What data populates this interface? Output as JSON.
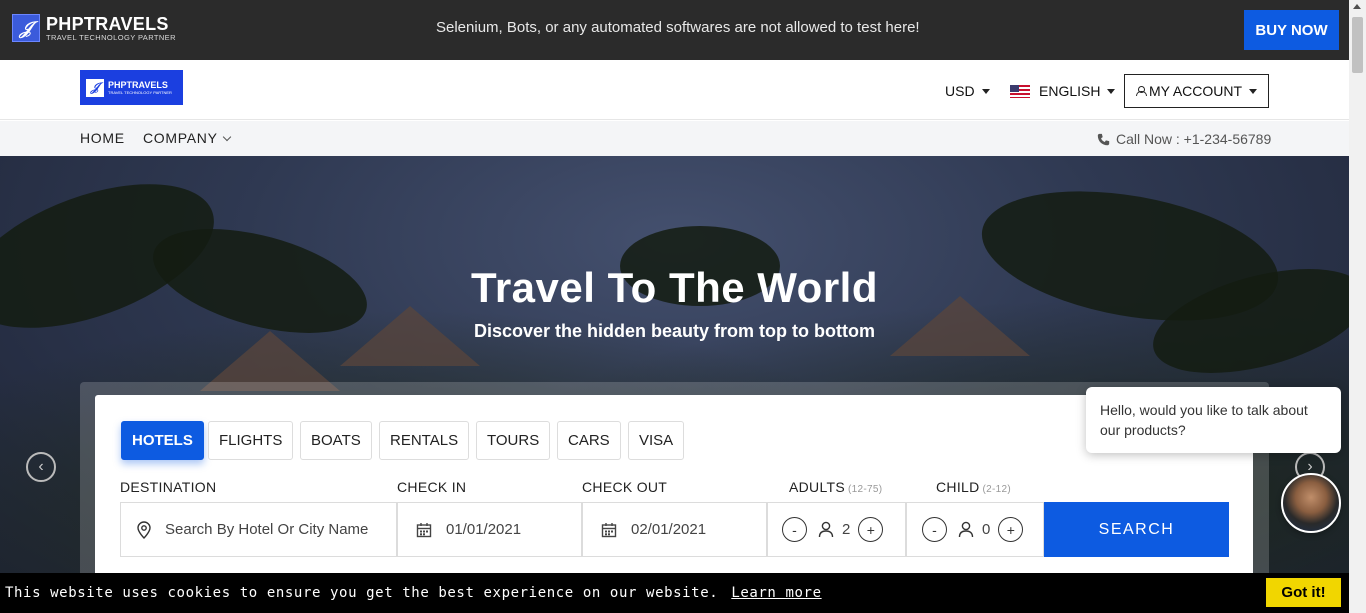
{
  "topbar": {
    "brand": "PHPTRAVELS",
    "brand_sub": "TRAVEL TECHNOLOGY PARTNER",
    "notice": "Selenium, Bots, or any automated softwares are not allowed to test here!",
    "buy_label": "BUY NOW"
  },
  "header": {
    "logo_text": "PHPTRAVELS",
    "logo_sub": "TRAVEL TECHNOLOGY PARTNER",
    "currency": "USD",
    "language": "ENGLISH",
    "account": "MY ACCOUNT"
  },
  "nav": {
    "home": "HOME",
    "company": "COMPANY",
    "call": "Call Now : +1-234-56789"
  },
  "hero": {
    "title": "Travel To The World",
    "subtitle": "Discover the hidden beauty from top to bottom",
    "prev_icon": "‹",
    "next_icon": "›"
  },
  "search": {
    "tabs": [
      "HOTELS",
      "FLIGHTS",
      "BOATS",
      "RENTALS",
      "TOURS",
      "CARS",
      "VISA"
    ],
    "active_tab": "HOTELS",
    "destination_label": "DESTINATION",
    "destination_placeholder": "Search By Hotel Or City Name",
    "checkin_label": "CHECK IN",
    "checkin_value": "01/01/2021",
    "checkout_label": "CHECK OUT",
    "checkout_value": "02/01/2021",
    "adults_label": "ADULTS",
    "adults_range": "(12-75)",
    "adults_value": "2",
    "child_label": "CHILD",
    "child_range": "(2-12)",
    "child_value": "0",
    "minus": "-",
    "plus": "+",
    "search_label": "SEARCH"
  },
  "chat": {
    "message": "Hello, would you like to talk about our products?"
  },
  "cookie": {
    "message": "This website uses cookies to ensure you get the best experience on our website.",
    "learn_more": "Learn more",
    "accept": "Got it!"
  },
  "colors": {
    "primary": "#0d5be1",
    "topbar": "#2b2b2b",
    "cookie_button": "#f1d600"
  }
}
